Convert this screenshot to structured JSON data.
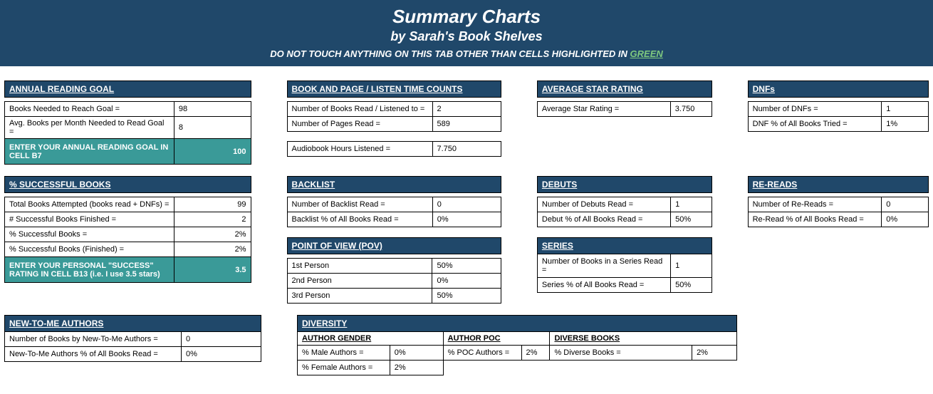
{
  "banner": {
    "title": "Summary Charts",
    "subtitle": "by Sarah's Book Shelves",
    "warning_prefix": "DO NOT TOUCH ANYTHING ON THIS TAB OTHER THAN CELLS HIGHLIGHTED IN",
    "warning_green": "GREEN"
  },
  "goal": {
    "header": "ANNUAL READING GOAL",
    "row1_label": "Books Needed to Reach Goal =",
    "row1_value": "98",
    "row2_label": "Avg. Books per Month Needed to Read Goal =",
    "row2_value": "8",
    "input_label": "ENTER YOUR ANNUAL READING GOAL IN CELL B7",
    "input_value": "100"
  },
  "bookpage": {
    "header": "BOOK AND PAGE / LISTEN TIME COUNTS",
    "row1_label": "Number of Books Read / Listened to =",
    "row1_value": "2",
    "row2_label": "Number of Pages Read =",
    "row2_value": "589",
    "row3_label": "Audiobook Hours Listened =",
    "row3_value": "7.750"
  },
  "avg": {
    "header": "AVERAGE STAR RATING",
    "row1_label": "Average Star Rating =",
    "row1_value": "3.750"
  },
  "dnf": {
    "header": "DNFs",
    "row1_label": "Number of DNFs =",
    "row1_value": "1",
    "row2_label": "DNF % of All Books Tried =",
    "row2_value": "1%"
  },
  "success": {
    "header": "% SUCCESSFUL BOOKS",
    "row1_label": "Total Books Attempted (books read + DNFs) =",
    "row1_value": "99",
    "row2_label": "# Successful Books Finished =",
    "row2_value": "2",
    "row3_label": "% Successful Books =",
    "row3_value": "2%",
    "row4_label": "% Successful Books (Finished) =",
    "row4_value": "2%",
    "input_label": "ENTER YOUR PERSONAL \"SUCCESS\" RATING IN CELL B13 (i.e. I use 3.5 stars)",
    "input_value": "3.5"
  },
  "backlist": {
    "header": "BACKLIST",
    "row1_label": "Number of Backlist Read =",
    "row1_value": "0",
    "row2_label": "Backlist % of All Books Read =",
    "row2_value": "0%"
  },
  "debuts": {
    "header": "DEBUTS",
    "row1_label": "Number of Debuts Read =",
    "row1_value": "1",
    "row2_label": "Debut % of All Books Read =",
    "row2_value": "50%"
  },
  "rereads": {
    "header": "RE-READS",
    "row1_label": "Number of Re-Reads =",
    "row1_value": "0",
    "row2_label": "Re-Read % of All Books Read =",
    "row2_value": "0%"
  },
  "pov": {
    "header": "POINT OF VIEW (POV)",
    "row1_label": "1st Person",
    "row1_value": "50%",
    "row2_label": "2nd Person",
    "row2_value": "0%",
    "row3_label": "3rd Person",
    "row3_value": "50%"
  },
  "series": {
    "header": "SERIES",
    "row1_label": "Number of Books in a Series Read =",
    "row1_value": "1",
    "row2_label": "Series % of All Books Read =",
    "row2_value": "50%"
  },
  "newauthors": {
    "header": "NEW-TO-ME AUTHORS",
    "row1_label": "Number of Books by New-To-Me Authors =",
    "row1_value": "0",
    "row2_label": "New-To-Me Authors % of All Books Read =",
    "row2_value": "0%"
  },
  "diversity": {
    "header": "DIVERSITY",
    "sub_gender": "AUTHOR GENDER",
    "male_label": "% Male Authors =",
    "male_value": "0%",
    "female_label": "% Female Authors =",
    "female_value": "2%",
    "sub_poc": "AUTHOR POC",
    "poc_label": "% POC Authors =",
    "poc_value": "2%",
    "sub_books": "DIVERSE BOOKS",
    "books_label": "% Diverse Books =",
    "books_value": "2%"
  }
}
